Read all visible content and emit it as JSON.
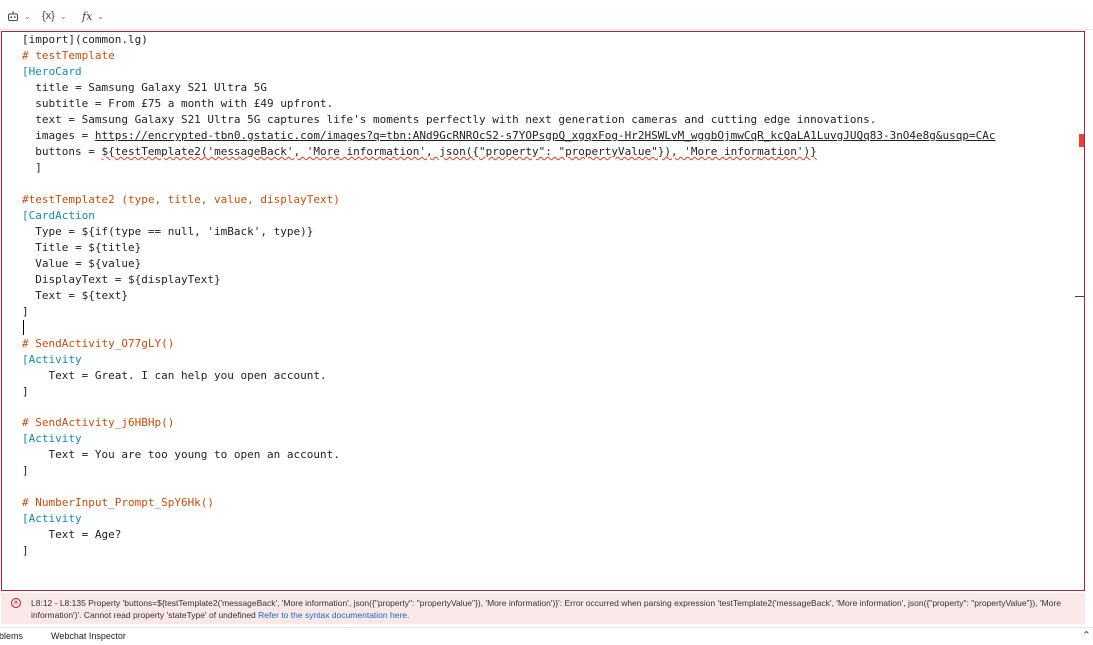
{
  "toolbar": {
    "items": [
      {
        "label": "",
        "icon": "robot-icon"
      },
      {
        "label": "{x}",
        "icon": "variables-icon"
      },
      {
        "label": "fx",
        "icon": "function-icon"
      }
    ]
  },
  "editor": {
    "lines": [
      "[import](common.lg)",
      "# testTemplate",
      "[HeroCard",
      "  title = Samsung Galaxy S21 Ultra 5G",
      "  subtitle = From £75 a month with £49 upfront.",
      "  text = Samsung Galaxy S21 Ultra 5G captures life's moments perfectly with next generation cameras and cutting edge innovations.",
      "  images = ",
      "https://encrypted-tbn0.gstatic.com/images?q=tbn:ANd9GcRNROcS2-s7YOPsgpQ_xgqxFog-Hr2HSWLvM_wggbOjmwCqR_kcQaLA1LuvgJUQq83-3nO4e8g&usqp=CAc",
      "  buttons = ",
      "${testTemplate2('messageBack', 'More information', json({\"property\": \"propertyValue\"}), 'More information')}",
      "  ]",
      "#testTemplate2 (type, title, value, displayText)",
      "[CardAction",
      "  Type = ${if(type == null, 'imBack', type)}",
      "  Title = ${title}",
      "  Value = ${value}",
      "  DisplayText = ${displayText}",
      "  Text = ${text}",
      "]",
      "# SendActivity_O77gLY()",
      "[Activity",
      "    Text = Great. I can help you open account.",
      "]",
      "# SendActivity_j6HBHp()",
      "[Activity",
      "    Text = You are too young to open an account.",
      "]",
      "# NumberInput_Prompt_SpY6Hk()",
      "[Activity",
      "    Text = Age?",
      "]"
    ]
  },
  "error": {
    "icon": "error-circle-icon",
    "message": "L8:12 - L8:135 Property 'buttons=${testTemplate2('messageBack', 'More information', json({\"property\": \"propertyValue\"}), 'More information')}': Error occurred when parsing expression 'testTemplate2('messageBack', 'More information', json({\"property\": \"propertyValue\"}), 'More information')'. Cannot read property 'stateType' of undefined",
    "link": "Refer to the syntax documentation here."
  },
  "bottom_tabs": [
    "oblems",
    "Webchat Inspector"
  ],
  "colors": {
    "accent_border": "#b0213a",
    "error_bg": "#fbe9ea",
    "comment": "#c24e0c",
    "keyword": "#1a8aa0",
    "template": "#2c55b0",
    "link": "#1a67c5"
  }
}
